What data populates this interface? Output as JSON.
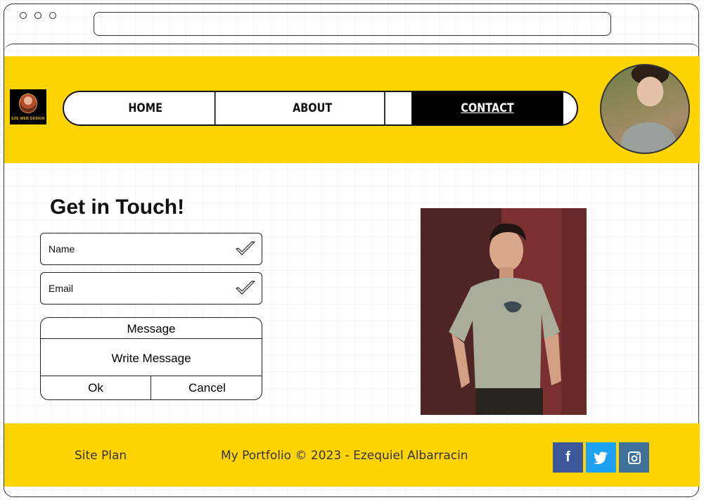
{
  "nav": {
    "logo_text": "EZE WEB DESIGN",
    "items": [
      {
        "label": "HOME",
        "active": false
      },
      {
        "label": "ABOUT",
        "active": false
      },
      {
        "label": "CONTACT",
        "active": true
      }
    ]
  },
  "contact": {
    "heading": "Get in Touch!",
    "name_label": "Name",
    "email_label": "Email",
    "message": {
      "title": "Message",
      "placeholder": "Write Message",
      "ok_label": "Ok",
      "cancel_label": "Cancel"
    }
  },
  "footer": {
    "site_plan": "Site Plan",
    "copyright": "My Portfolio © 2023 - Ezequiel Albarracin",
    "social": [
      {
        "icon": "facebook-icon",
        "glyph": "f",
        "color": "#3b5998"
      },
      {
        "icon": "twitter-icon",
        "glyph": "🐦",
        "color": "#1da1f2"
      },
      {
        "icon": "instagram-icon",
        "glyph": "◘",
        "color": "#3f729b"
      }
    ]
  },
  "colors": {
    "accent_yellow": "#ffd400",
    "active_nav_bg": "#000000"
  }
}
